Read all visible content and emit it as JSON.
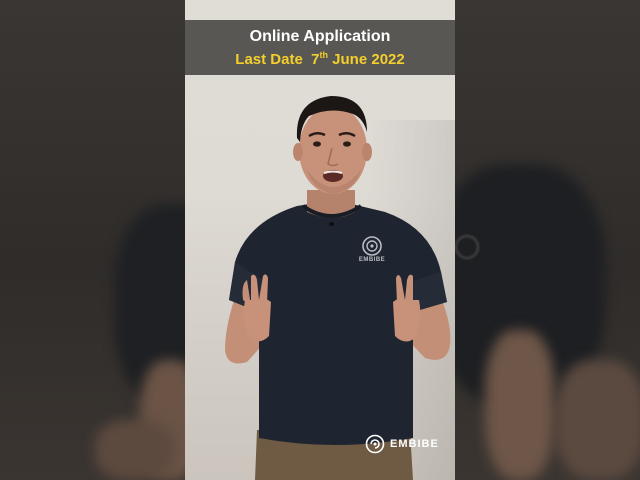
{
  "banner": {
    "title": "Online Application",
    "last_date_label": "Last Date",
    "day": "7",
    "day_suffix": "th",
    "month_year": "June 2022"
  },
  "watermark": {
    "text": "EMBIBE",
    "icon": "embibe-logo-icon"
  },
  "shirt_logo": {
    "text": "EMBIBE",
    "icon": "embibe-logo-icon"
  },
  "colors": {
    "banner_title": "#ffffff",
    "banner_date": "#f4cf2c",
    "shirt": "#1f2530"
  }
}
